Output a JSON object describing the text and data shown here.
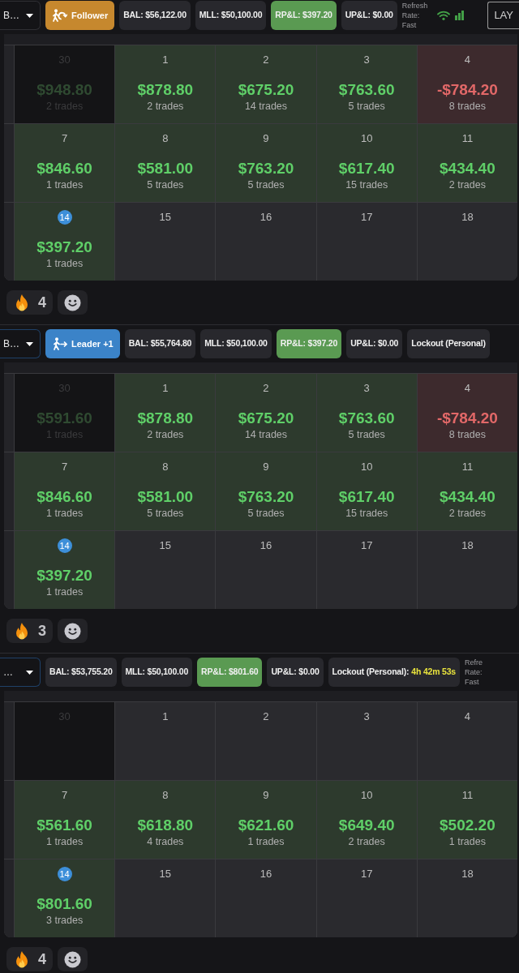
{
  "posts": [
    {
      "toolbar": {
        "items": [
          {
            "kind": "account",
            "label": "B…",
            "focused": false
          },
          {
            "kind": "follower",
            "label": "Follower"
          },
          {
            "kind": "stat",
            "label": "BAL: $56,122.00",
            "highlighted": false
          },
          {
            "kind": "stat",
            "label": "MLL: $50,100.00",
            "highlighted": false
          },
          {
            "kind": "stat",
            "label": "RP&L: $397.20",
            "highlighted": true
          },
          {
            "kind": "stat",
            "label": "UP&L: $0.00",
            "highlighted": false
          },
          {
            "kind": "refresh",
            "label": "Refresh Rate: Fast"
          },
          {
            "kind": "connection"
          },
          {
            "kind": "layout",
            "label": "LAY"
          }
        ]
      },
      "calendar": {
        "weeks": [
          [
            {
              "day": "30",
              "outside_month": true,
              "today": false,
              "kind": "profit",
              "amount": "$948.80",
              "trades": "2 trades"
            },
            {
              "day": "1",
              "outside_month": false,
              "today": false,
              "kind": "profit",
              "amount": "$878.80",
              "trades": "2 trades"
            },
            {
              "day": "2",
              "outside_month": false,
              "today": false,
              "kind": "profit",
              "amount": "$675.20",
              "trades": "14 trades"
            },
            {
              "day": "3",
              "outside_month": false,
              "today": false,
              "kind": "profit",
              "amount": "$763.60",
              "trades": "5 trades"
            },
            {
              "day": "4",
              "outside_month": false,
              "today": false,
              "kind": "loss",
              "amount": "-$784.20",
              "trades": "8 trades"
            }
          ],
          [
            {
              "day": "7",
              "outside_month": false,
              "today": false,
              "kind": "profit",
              "amount": "$846.60",
              "trades": "1 trades"
            },
            {
              "day": "8",
              "outside_month": false,
              "today": false,
              "kind": "profit",
              "amount": "$581.00",
              "trades": "5 trades"
            },
            {
              "day": "9",
              "outside_month": false,
              "today": false,
              "kind": "profit",
              "amount": "$763.20",
              "trades": "5 trades"
            },
            {
              "day": "10",
              "outside_month": false,
              "today": false,
              "kind": "profit",
              "amount": "$617.40",
              "trades": "15 trades"
            },
            {
              "day": "11",
              "outside_month": false,
              "today": false,
              "kind": "profit",
              "amount": "$434.40",
              "trades": "2 trades"
            }
          ],
          [
            {
              "day": "14",
              "outside_month": false,
              "today": true,
              "kind": "profit",
              "amount": "$397.20",
              "trades": "1 trades"
            },
            {
              "day": "15",
              "outside_month": false,
              "today": false,
              "kind": "empty"
            },
            {
              "day": "16",
              "outside_month": false,
              "today": false,
              "kind": "empty"
            },
            {
              "day": "17",
              "outside_month": false,
              "today": false,
              "kind": "empty"
            },
            {
              "day": "18",
              "outside_month": false,
              "today": false,
              "kind": "empty"
            }
          ]
        ]
      },
      "reactions": [
        {
          "kind": "emoji",
          "count": "4"
        },
        {
          "kind": "add"
        }
      ]
    },
    {
      "toolbar": {
        "items": [
          {
            "kind": "account",
            "label": "B…",
            "focused": true
          },
          {
            "kind": "leader",
            "label": "Leader +1"
          },
          {
            "kind": "stat",
            "label": "BAL: $55,764.80",
            "highlighted": false
          },
          {
            "kind": "stat",
            "label": "MLL: $50,100.00",
            "highlighted": false
          },
          {
            "kind": "stat",
            "label": "RP&L: $397.20",
            "highlighted": true
          },
          {
            "kind": "stat",
            "label": "UP&L: $0.00",
            "highlighted": false
          },
          {
            "kind": "lockout",
            "label": "Lockout (Personal)"
          }
        ]
      },
      "calendar": {
        "weeks": [
          [
            {
              "day": "30",
              "outside_month": true,
              "today": false,
              "kind": "profit",
              "amount": "$591.60",
              "trades": "1 trades"
            },
            {
              "day": "1",
              "outside_month": false,
              "today": false,
              "kind": "profit",
              "amount": "$878.80",
              "trades": "2 trades"
            },
            {
              "day": "2",
              "outside_month": false,
              "today": false,
              "kind": "profit",
              "amount": "$675.20",
              "trades": "14 trades"
            },
            {
              "day": "3",
              "outside_month": false,
              "today": false,
              "kind": "profit",
              "amount": "$763.60",
              "trades": "5 trades"
            },
            {
              "day": "4",
              "outside_month": false,
              "today": false,
              "kind": "loss",
              "amount": "-$784.20",
              "trades": "8 trades"
            }
          ],
          [
            {
              "day": "7",
              "outside_month": false,
              "today": false,
              "kind": "profit",
              "amount": "$846.60",
              "trades": "1 trades"
            },
            {
              "day": "8",
              "outside_month": false,
              "today": false,
              "kind": "profit",
              "amount": "$581.00",
              "trades": "5 trades"
            },
            {
              "day": "9",
              "outside_month": false,
              "today": false,
              "kind": "profit",
              "amount": "$763.20",
              "trades": "5 trades"
            },
            {
              "day": "10",
              "outside_month": false,
              "today": false,
              "kind": "profit",
              "amount": "$617.40",
              "trades": "15 trades"
            },
            {
              "day": "11",
              "outside_month": false,
              "today": false,
              "kind": "profit",
              "amount": "$434.40",
              "trades": "2 trades"
            }
          ],
          [
            {
              "day": "14",
              "outside_month": false,
              "today": true,
              "kind": "profit",
              "amount": "$397.20",
              "trades": "1 trades"
            },
            {
              "day": "15",
              "outside_month": false,
              "today": false,
              "kind": "empty"
            },
            {
              "day": "16",
              "outside_month": false,
              "today": false,
              "kind": "empty"
            },
            {
              "day": "17",
              "outside_month": false,
              "today": false,
              "kind": "empty"
            },
            {
              "day": "18",
              "outside_month": false,
              "today": false,
              "kind": "empty"
            }
          ]
        ]
      },
      "reactions": [
        {
          "kind": "emoji",
          "count": "3"
        },
        {
          "kind": "add"
        }
      ]
    },
    {
      "toolbar": {
        "items": [
          {
            "kind": "account",
            "label": "…",
            "focused": true
          },
          {
            "kind": "stat",
            "label": "BAL: $53,755.20",
            "highlighted": false
          },
          {
            "kind": "stat",
            "label": "MLL: $50,100.00",
            "highlighted": false
          },
          {
            "kind": "stat",
            "label": "RP&L: $801.60",
            "highlighted": true
          },
          {
            "kind": "stat",
            "label": "UP&L: $0.00",
            "highlighted": false
          },
          {
            "kind": "lockout",
            "label": "Lockout (Personal):",
            "timer": "4h 42m 53s"
          },
          {
            "kind": "refresh",
            "label": "Refre Rate: Fast"
          }
        ]
      },
      "calendar": {
        "weeks": [
          [
            {
              "day": "30",
              "outside_month": true,
              "today": false,
              "kind": "empty"
            },
            {
              "day": "1",
              "outside_month": false,
              "today": false,
              "kind": "empty"
            },
            {
              "day": "2",
              "outside_month": false,
              "today": false,
              "kind": "empty"
            },
            {
              "day": "3",
              "outside_month": false,
              "today": false,
              "kind": "empty"
            },
            {
              "day": "4",
              "outside_month": false,
              "today": false,
              "kind": "empty"
            }
          ],
          [
            {
              "day": "7",
              "outside_month": false,
              "today": false,
              "kind": "profit",
              "amount": "$561.60",
              "trades": "1 trades"
            },
            {
              "day": "8",
              "outside_month": false,
              "today": false,
              "kind": "profit",
              "amount": "$618.80",
              "trades": "4 trades"
            },
            {
              "day": "9",
              "outside_month": false,
              "today": false,
              "kind": "profit",
              "amount": "$621.60",
              "trades": "1 trades"
            },
            {
              "day": "10",
              "outside_month": false,
              "today": false,
              "kind": "profit",
              "amount": "$649.40",
              "trades": "2 trades"
            },
            {
              "day": "11",
              "outside_month": false,
              "today": false,
              "kind": "profit",
              "amount": "$502.20",
              "trades": "1 trades"
            }
          ],
          [
            {
              "day": "14",
              "outside_month": false,
              "today": true,
              "kind": "profit",
              "amount": "$801.60",
              "trades": "3 trades"
            },
            {
              "day": "15",
              "outside_month": false,
              "today": false,
              "kind": "empty"
            },
            {
              "day": "16",
              "outside_month": false,
              "today": false,
              "kind": "empty"
            },
            {
              "day": "17",
              "outside_month": false,
              "today": false,
              "kind": "empty"
            },
            {
              "day": "18",
              "outside_month": false,
              "today": false,
              "kind": "empty"
            }
          ]
        ]
      },
      "reactions": [
        {
          "kind": "emoji",
          "count": "4"
        },
        {
          "kind": "add"
        }
      ]
    }
  ]
}
